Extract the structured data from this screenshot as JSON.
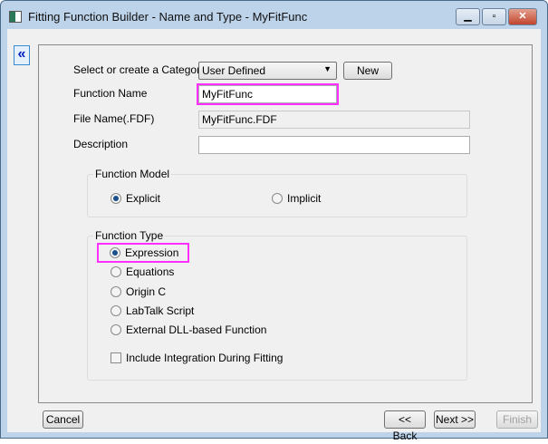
{
  "window": {
    "title": "Fitting Function Builder - Name and Type - MyFitFunc"
  },
  "form": {
    "category_label": "Select or create a Category",
    "category_value": "User Defined",
    "new_label": "New",
    "function_name_label": "Function Name",
    "function_name_value": "MyFitFunc",
    "file_name_label": "File Name(.FDF)",
    "file_name_value": "MyFitFunc.FDF",
    "description_label": "Description",
    "description_value": ""
  },
  "function_model": {
    "title": "Function Model",
    "options": [
      "Explicit",
      "Implicit"
    ],
    "selected": "Explicit"
  },
  "function_type": {
    "title": "Function Type",
    "options": [
      "Expression",
      "Equations",
      "Origin C",
      "LabTalk Script",
      "External DLL-based Function"
    ],
    "selected": "Expression",
    "include_integration_label": "Include Integration During Fitting",
    "include_integration_checked": false
  },
  "buttons": {
    "cancel": "Cancel",
    "back": "<< Back",
    "next": "Next >>",
    "finish": "Finish",
    "collapse": "«"
  },
  "highlight_color": "#ff30ff"
}
